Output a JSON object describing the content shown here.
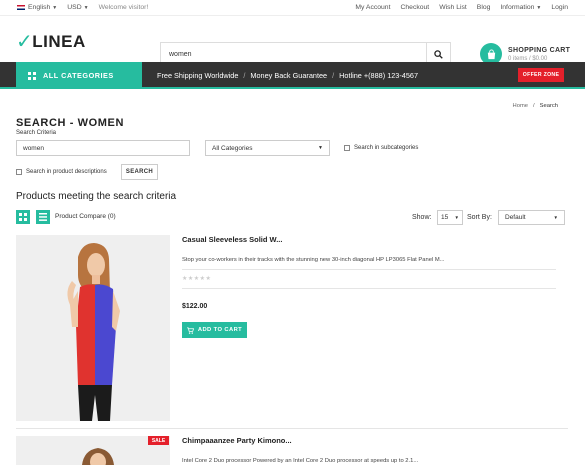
{
  "topbar": {
    "language": "English",
    "currency": "USD",
    "welcome": "Welcome visitor!",
    "links": [
      "My Account",
      "Checkout",
      "Wish List",
      "Blog",
      "Information",
      "Login"
    ]
  },
  "header": {
    "logo": "LINEA",
    "search_value": "women",
    "cart_title": "SHOPPING CART",
    "cart_summary": "0 items / $0.00"
  },
  "nav": {
    "all_categories": "ALL CATEGORIES",
    "msg_shipping": "Free Shipping Worldwide",
    "msg_money": "Money Back Guarantee",
    "msg_hotline": "Hotline +(888) 123-4567",
    "separator": "/",
    "offer": "OFFER ZONE"
  },
  "breadcrumb": {
    "home": "Home",
    "separator": "/",
    "current": "Search"
  },
  "search": {
    "title": "SEARCH - WOMEN",
    "criteria_label": "Search Criteria",
    "keyword": "women",
    "category": "All Categories",
    "subcategories_label": "Search in subcategories",
    "descriptions_label": "Search in product descriptions",
    "button": "SEARCH"
  },
  "results": {
    "title": "Products meeting the search criteria",
    "compare": "Product Compare (0)",
    "show_label": "Show:",
    "show_value": "15",
    "sort_label": "Sort By:",
    "sort_value": "Default"
  },
  "products": [
    {
      "name": "Casual Sleeveless Solid W...",
      "description": "Stop your co-workers in their tracks with the stunning new 30-inch diagonal HP LP3065 Flat Panel M...",
      "stars": "★★★★★",
      "price": "$122.00",
      "add_to_cart": "ADD TO CART"
    },
    {
      "name": "Chimpaaanzee Party Kimono...",
      "description": "Intel Core 2 Duo processor Powered by an Intel Core 2 Duo processor at speeds up to 2.1...",
      "badge": "SALE"
    }
  ],
  "colors": {
    "accent": "#26bc9f",
    "nav_bg": "#333333",
    "offer": "#e4202b"
  }
}
